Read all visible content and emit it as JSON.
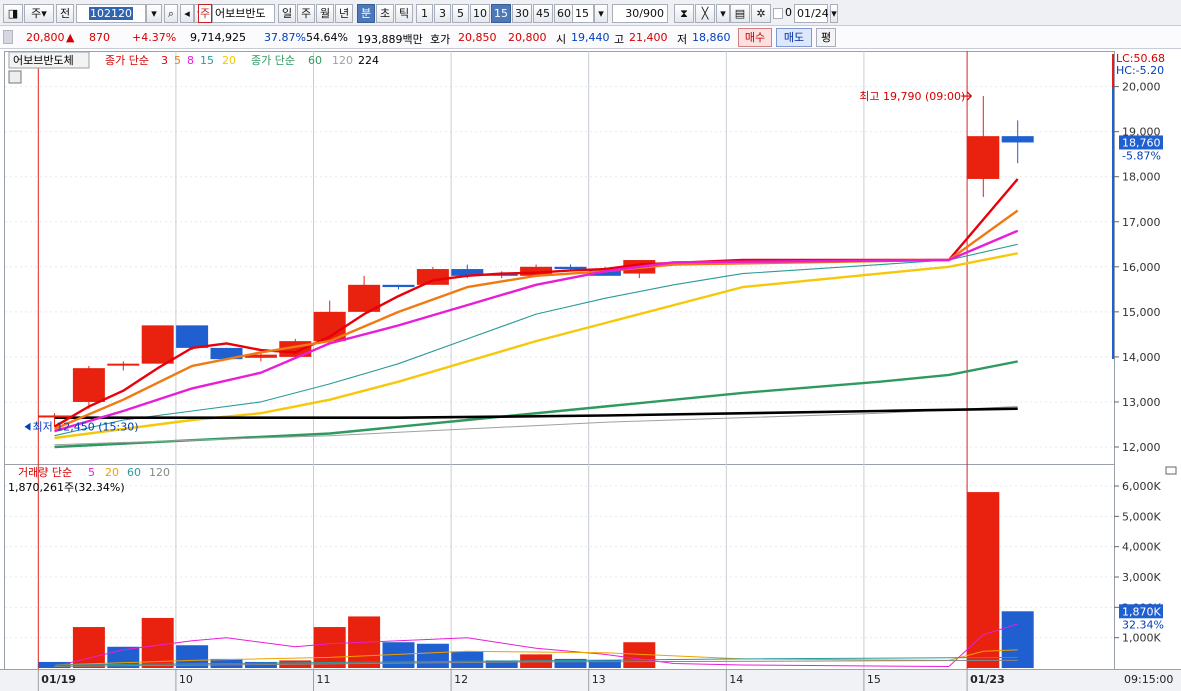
{
  "toolbar": {
    "market": "주",
    "prev_label": "전",
    "stock_code": "102120",
    "stock_name": "어보브반도",
    "stock_badge": "주",
    "period_buttons": [
      "일",
      "주",
      "월",
      "년",
      "분",
      "초",
      "틱"
    ],
    "selected_period": "분",
    "interval_buttons": [
      "1",
      "3",
      "5",
      "10",
      "15",
      "30",
      "45",
      "60"
    ],
    "selected_interval": "15",
    "interval_value": "15",
    "count_display": "30/900",
    "checkbox_value": "0",
    "date_display": "01/24"
  },
  "quote": {
    "price": "20,800",
    "direction_symbol": "▲",
    "change": "870",
    "change_pct": "+4.37%",
    "volume": "9,714,925",
    "ratio1": "37.87%",
    "ratio2": "54.64%",
    "trade_value": "193,889백만",
    "quote_label": "호가",
    "ask": "20,850",
    "bid": "20,800",
    "open_label": "시",
    "open": "19,440",
    "high_label": "고",
    "high": "21,400",
    "low_label": "저",
    "low": "18,860",
    "buy_button": "매수",
    "sell_button": "매도",
    "eval_button": "평"
  },
  "legend": {
    "stock": "어보브반도체",
    "ma1_title": "종가 단순",
    "ma1_periods": [
      "3",
      "5",
      "8",
      "15",
      "20"
    ],
    "ma2_title": "종가 단순",
    "ma2_periods": [
      "60",
      "120",
      "224"
    ],
    "vol_title": "거래량 단순",
    "vol_periods": [
      "5",
      "20",
      "60",
      "120"
    ],
    "vol_value": "1,870,261주(32.34%)"
  },
  "right_info": {
    "lc": "LC:50.68",
    "hc": "HC:-5.20",
    "price_tag": "18,760",
    "price_pct": "-5.87%",
    "vol_tag": "1,870K",
    "vol_pct": "32.34%"
  },
  "annotations": {
    "high": "최고 19,790 (09:00)",
    "low": "최저 12,450 (15:30)"
  },
  "x_labels": [
    "01/19",
    "10",
    "11",
    "12",
    "13",
    "14",
    "15",
    "01/23"
  ],
  "time_label": "09:15:00",
  "colors": {
    "up": "#e8220e",
    "down": "#1f5fd0",
    "ma3": "#e8000a",
    "ma5": "#f07a12",
    "ma8": "#e81ed7",
    "ma15": "#2a9a9a",
    "ma20": "#f5c80a",
    "ma60": "#2f9a60",
    "ma120": "#a0a0a0",
    "ma224": "#000000"
  },
  "chart_data": {
    "type": "candlestick",
    "price_axis": {
      "ticks": [
        12000,
        13000,
        14000,
        15000,
        16000,
        17000,
        18000,
        19000,
        20000
      ]
    },
    "candles": [
      {
        "x": 0,
        "open": 12700,
        "high": 12750,
        "low": 12450,
        "close": 12700
      },
      {
        "x": 1,
        "open": 13000,
        "high": 13800,
        "low": 12850,
        "close": 13750
      },
      {
        "x": 2,
        "open": 13850,
        "high": 13900,
        "low": 13700,
        "close": 13850
      },
      {
        "x": 3,
        "open": 13850,
        "high": 14700,
        "low": 13850,
        "close": 14700
      },
      {
        "x": 4,
        "open": 14700,
        "high": 14700,
        "low": 14150,
        "close": 14200
      },
      {
        "x": 5,
        "open": 14200,
        "high": 14200,
        "low": 14000,
        "close": 13950
      },
      {
        "x": 6,
        "open": 13980,
        "high": 14100,
        "low": 13900,
        "close": 14050
      },
      {
        "x": 7,
        "open": 14000,
        "high": 14400,
        "low": 14000,
        "close": 14350
      },
      {
        "x": 8,
        "open": 14350,
        "high": 15250,
        "low": 14300,
        "close": 15000
      },
      {
        "x": 9,
        "open": 15000,
        "high": 15800,
        "low": 15000,
        "close": 15600
      },
      {
        "x": 10,
        "open": 15600,
        "high": 15600,
        "low": 15500,
        "close": 15550
      },
      {
        "x": 11,
        "open": 15600,
        "high": 16000,
        "low": 15600,
        "close": 15950
      },
      {
        "x": 12,
        "open": 15950,
        "high": 16050,
        "low": 15750,
        "close": 15800
      },
      {
        "x": 13,
        "open": 15850,
        "high": 15900,
        "low": 15750,
        "close": 15800
      },
      {
        "x": 14,
        "open": 15800,
        "high": 16050,
        "low": 15800,
        "close": 16000
      },
      {
        "x": 15,
        "open": 16000,
        "high": 16050,
        "low": 15900,
        "close": 15950
      },
      {
        "x": 16,
        "open": 15950,
        "high": 16000,
        "low": 15800,
        "close": 15800
      },
      {
        "x": 17,
        "open": 15850,
        "high": 16150,
        "low": 15750,
        "close": 16150
      },
      {
        "x": 27,
        "open": 17950,
        "high": 19790,
        "low": 17550,
        "close": 18900
      },
      {
        "x": 28,
        "open": 18900,
        "high": 19250,
        "low": 18300,
        "close": 18760
      }
    ],
    "moving_averages": [
      {
        "name": "3",
        "points": [
          [
            0,
            12450
          ],
          [
            1,
            12900
          ],
          [
            2,
            13250
          ],
          [
            3,
            13750
          ],
          [
            4,
            14200
          ],
          [
            5,
            14300
          ],
          [
            6,
            14150
          ],
          [
            7,
            14100
          ],
          [
            8,
            14450
          ],
          [
            9,
            14950
          ],
          [
            10,
            15350
          ],
          [
            11,
            15700
          ],
          [
            12,
            15800
          ],
          [
            13,
            15850
          ],
          [
            14,
            15870
          ],
          [
            15,
            15920
          ],
          [
            16,
            15950
          ],
          [
            17,
            16050
          ],
          [
            20,
            16150
          ],
          [
            26,
            16150
          ],
          [
            28,
            17950
          ]
        ]
      },
      {
        "name": "5",
        "points": [
          [
            0,
            12400
          ],
          [
            2,
            13050
          ],
          [
            4,
            13800
          ],
          [
            6,
            14100
          ],
          [
            8,
            14350
          ],
          [
            10,
            15000
          ],
          [
            12,
            15550
          ],
          [
            14,
            15800
          ],
          [
            16,
            15900
          ],
          [
            18,
            16050
          ],
          [
            26,
            16150
          ],
          [
            28,
            17250
          ]
        ]
      },
      {
        "name": "8",
        "points": [
          [
            0,
            12350
          ],
          [
            2,
            12800
          ],
          [
            4,
            13300
          ],
          [
            6,
            13650
          ],
          [
            8,
            14300
          ],
          [
            10,
            14700
          ],
          [
            12,
            15150
          ],
          [
            14,
            15600
          ],
          [
            16,
            15900
          ],
          [
            18,
            16100
          ],
          [
            26,
            16150
          ],
          [
            28,
            16800
          ]
        ]
      },
      {
        "name": "15",
        "points": [
          [
            0,
            12250
          ],
          [
            2,
            12600
          ],
          [
            4,
            12800
          ],
          [
            6,
            13000
          ],
          [
            8,
            13400
          ],
          [
            10,
            13850
          ],
          [
            12,
            14400
          ],
          [
            14,
            14950
          ],
          [
            16,
            15300
          ],
          [
            18,
            15600
          ],
          [
            20,
            15850
          ],
          [
            22,
            15950
          ],
          [
            26,
            16150
          ],
          [
            28,
            16500
          ]
        ]
      },
      {
        "name": "20",
        "points": [
          [
            0,
            12200
          ],
          [
            2,
            12400
          ],
          [
            4,
            12600
          ],
          [
            6,
            12750
          ],
          [
            8,
            13050
          ],
          [
            10,
            13450
          ],
          [
            12,
            13900
          ],
          [
            14,
            14350
          ],
          [
            16,
            14750
          ],
          [
            18,
            15150
          ],
          [
            20,
            15550
          ],
          [
            22,
            15700
          ],
          [
            24,
            15850
          ],
          [
            26,
            16000
          ],
          [
            28,
            16300
          ]
        ]
      },
      {
        "name": "60",
        "points": [
          [
            0,
            12000
          ],
          [
            4,
            12150
          ],
          [
            8,
            12300
          ],
          [
            12,
            12600
          ],
          [
            16,
            12900
          ],
          [
            20,
            13200
          ],
          [
            24,
            13450
          ],
          [
            26,
            13600
          ],
          [
            28,
            13900
          ]
        ]
      },
      {
        "name": "120",
        "points": [
          [
            0,
            12050
          ],
          [
            8,
            12250
          ],
          [
            16,
            12550
          ],
          [
            24,
            12750
          ],
          [
            28,
            12900
          ]
        ]
      },
      {
        "name": "224",
        "points": [
          [
            0,
            12650
          ],
          [
            10,
            12650
          ],
          [
            16,
            12700
          ],
          [
            24,
            12800
          ],
          [
            28,
            12850
          ]
        ]
      }
    ],
    "volume_axis": {
      "ticks": [
        1000,
        2000,
        3000,
        4000,
        5000,
        6000
      ],
      "unit": "K"
    },
    "volume": [
      {
        "x": 0,
        "value": 200,
        "dir": "down"
      },
      {
        "x": 1,
        "value": 1350,
        "dir": "up"
      },
      {
        "x": 2,
        "value": 700,
        "dir": "down"
      },
      {
        "x": 3,
        "value": 1650,
        "dir": "up"
      },
      {
        "x": 4,
        "value": 750,
        "dir": "down"
      },
      {
        "x": 5,
        "value": 300,
        "dir": "down"
      },
      {
        "x": 6,
        "value": 200,
        "dir": "down"
      },
      {
        "x": 7,
        "value": 250,
        "dir": "up"
      },
      {
        "x": 8,
        "value": 1350,
        "dir": "up"
      },
      {
        "x": 9,
        "value": 1700,
        "dir": "up"
      },
      {
        "x": 10,
        "value": 850,
        "dir": "down"
      },
      {
        "x": 11,
        "value": 800,
        "dir": "down"
      },
      {
        "x": 12,
        "value": 550,
        "dir": "down"
      },
      {
        "x": 13,
        "value": 250,
        "dir": "down"
      },
      {
        "x": 14,
        "value": 450,
        "dir": "up"
      },
      {
        "x": 15,
        "value": 300,
        "dir": "down"
      },
      {
        "x": 16,
        "value": 250,
        "dir": "down"
      },
      {
        "x": 17,
        "value": 850,
        "dir": "up"
      },
      {
        "x": 27,
        "value": 5800,
        "dir": "up"
      },
      {
        "x": 28,
        "value": 1870,
        "dir": "down"
      }
    ],
    "volume_ma": [
      {
        "name": "5",
        "points": [
          [
            0,
            50
          ],
          [
            2,
            600
          ],
          [
            4,
            900
          ],
          [
            5,
            1000
          ],
          [
            7,
            700
          ],
          [
            8,
            800
          ],
          [
            10,
            900
          ],
          [
            12,
            1000
          ],
          [
            14,
            650
          ],
          [
            16,
            450
          ],
          [
            18,
            150
          ],
          [
            20,
            100
          ],
          [
            26,
            50
          ],
          [
            27,
            1100
          ],
          [
            28,
            1450
          ]
        ]
      },
      {
        "name": "20",
        "points": [
          [
            0,
            100
          ],
          [
            4,
            250
          ],
          [
            8,
            350
          ],
          [
            12,
            550
          ],
          [
            16,
            500
          ],
          [
            20,
            300
          ],
          [
            26,
            250
          ],
          [
            27,
            550
          ],
          [
            28,
            600
          ]
        ]
      },
      {
        "name": "60",
        "points": [
          [
            0,
            100
          ],
          [
            10,
            200
          ],
          [
            20,
            300
          ],
          [
            28,
            350
          ]
        ]
      },
      {
        "name": "120",
        "points": [
          [
            0,
            50
          ],
          [
            14,
            200
          ],
          [
            28,
            250
          ]
        ]
      }
    ]
  }
}
